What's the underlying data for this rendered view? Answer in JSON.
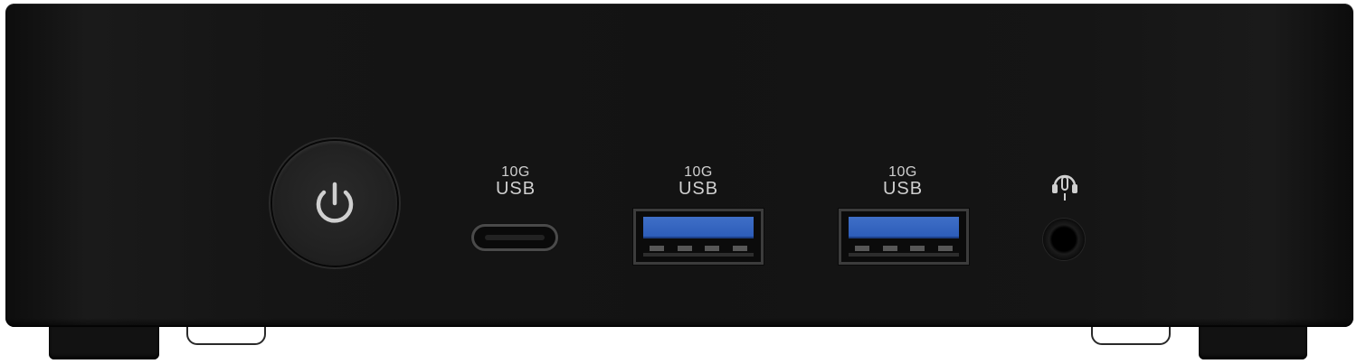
{
  "ports": {
    "usb_c": {
      "speed": "10G",
      "type": "USB"
    },
    "usb_a_1": {
      "speed": "10G",
      "type": "USB"
    },
    "usb_a_2": {
      "speed": "10G",
      "type": "USB"
    }
  },
  "icons": {
    "power": "power-icon",
    "audio": "headset-mic-icon"
  },
  "colors": {
    "chassis": "#141414",
    "usb3_port": "#3464c4",
    "label": "#cfcfcf"
  }
}
